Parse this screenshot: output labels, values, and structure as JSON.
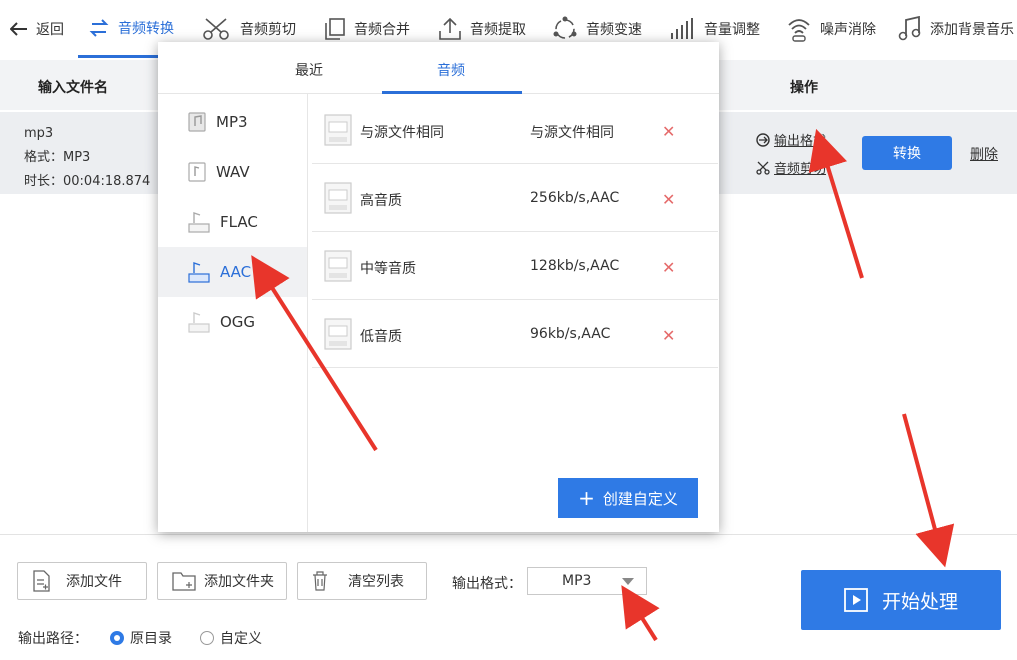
{
  "toolbar": {
    "back_label": "返回",
    "items": [
      {
        "label": "音频转换",
        "icon": "convert-icon"
      },
      {
        "label": "音频剪切",
        "icon": "scissors-icon"
      },
      {
        "label": "音频合并",
        "icon": "merge-icon"
      },
      {
        "label": "音频提取",
        "icon": "upload-icon"
      },
      {
        "label": "音频变速",
        "icon": "speed-icon"
      },
      {
        "label": "音量调整",
        "icon": "volume-bars-icon"
      },
      {
        "label": "噪声消除",
        "icon": "noise-icon"
      },
      {
        "label": "添加背景音乐",
        "icon": "music-note-icon"
      }
    ],
    "active_index": 0
  },
  "table": {
    "col_filename": "输入文件名",
    "col_actions": "操作"
  },
  "file": {
    "name": "mp3",
    "format_line": "格式：MP3",
    "duration_line": "时长：00:04:18.874",
    "output_format_link": "输出格式",
    "audio_cut_link": "音频剪切",
    "convert_button": "转换",
    "delete_link": "删除"
  },
  "popup": {
    "tabs": [
      "最近",
      "音频"
    ],
    "active_tab": 1,
    "formats": [
      "MP3",
      "WAV",
      "FLAC",
      "AAC",
      "OGG"
    ],
    "selected_format": "AAC",
    "presets": [
      {
        "name": "与源文件相同",
        "value": "与源文件相同"
      },
      {
        "name": "高音质",
        "value": "256kb/s,AAC"
      },
      {
        "name": "中等音质",
        "value": "128kb/s,AAC"
      },
      {
        "name": "低音质",
        "value": "96kb/s,AAC"
      }
    ],
    "delete_glyph": "✕",
    "create_button": "创建自定义",
    "create_button_glyph": "+"
  },
  "bottom": {
    "add_file": "添加文件",
    "add_folder": "添加文件夹",
    "clear_list": "清空列表",
    "output_format_label": "输出格式：",
    "output_format_value": "MP3",
    "start_button": "开始处理",
    "output_path_label": "输出路径：",
    "radio_original": "原目录",
    "radio_custom": "自定义",
    "radio_selected": "原目录"
  },
  "colors": {
    "accent": "#2f7ae5",
    "arrow": "#e8352b",
    "delete_x": "#e56a6a"
  }
}
